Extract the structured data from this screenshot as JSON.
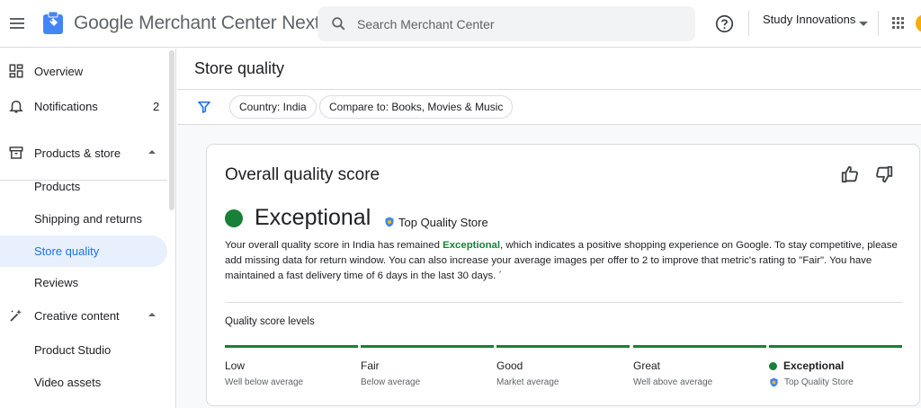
{
  "topbar": {
    "app_title": "Google Merchant Center Next",
    "search_placeholder": "Search Merchant Center",
    "account_name": "Study Innovations"
  },
  "sidebar": {
    "items": [
      {
        "label": "Overview",
        "icon": "dashboard-icon"
      },
      {
        "label": "Notifications",
        "icon": "bell-icon",
        "badge": "2"
      },
      {
        "label": "Products & store",
        "icon": "store-icon"
      },
      {
        "label": "Products"
      },
      {
        "label": "Shipping and returns"
      },
      {
        "label": "Store quality",
        "active": true
      },
      {
        "label": "Reviews"
      },
      {
        "label": "Creative content",
        "icon": "magic-wand-icon"
      },
      {
        "label": "Product Studio"
      },
      {
        "label": "Video assets"
      }
    ]
  },
  "page": {
    "title": "Store quality",
    "filters": [
      "Country: India",
      "Compare to: Books, Movies & Music"
    ]
  },
  "card": {
    "title": "Overall quality score",
    "score": "Exceptional",
    "badge": "Top Quality Store",
    "description_before": "Your overall quality score in India has remained ",
    "description_highlight": "Exceptional",
    "description_after": ", which indicates a positive shopping experience on Google. To stay competitive, please add missing data for return window. You can also increase your average images per offer to 2 to improve that metric's rating to \"Fair\". You have maintained a fast delivery time of 6 days in the last 30 days. ´",
    "levels_heading": "Quality score levels",
    "levels": [
      {
        "name": "Low",
        "sub": "Well below average"
      },
      {
        "name": "Fair",
        "sub": "Below average"
      },
      {
        "name": "Good",
        "sub": "Market average"
      },
      {
        "name": "Great",
        "sub": "Well above average"
      },
      {
        "name": "Exceptional",
        "sub": "Top Quality Store"
      }
    ]
  },
  "colors": {
    "accent": "#1a73e8",
    "success": "#188038"
  }
}
